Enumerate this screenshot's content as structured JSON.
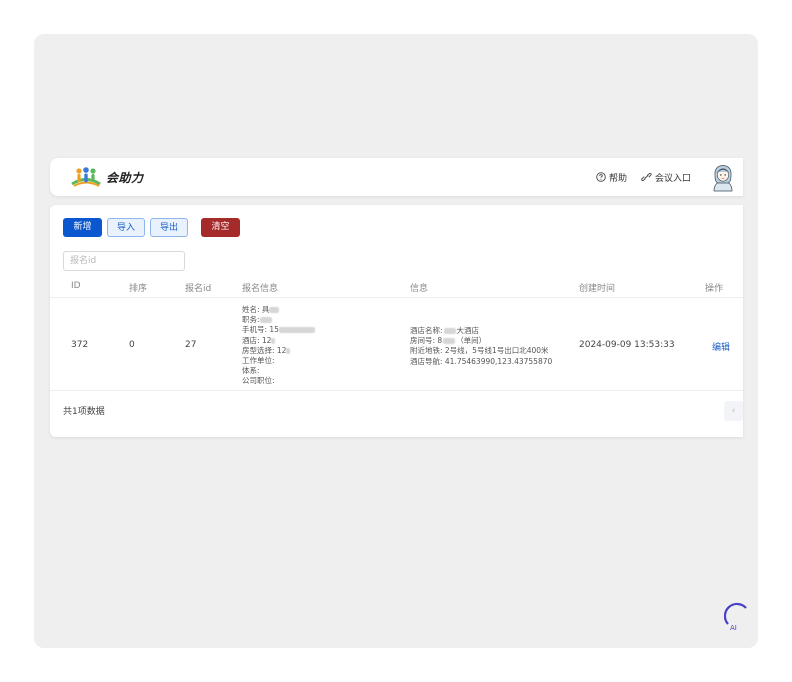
{
  "header": {
    "logo_text": "会助力",
    "help_label": "帮助",
    "meeting_entry_label": "会议入口"
  },
  "toolbar": {
    "add_label": "新增",
    "import_label": "导入",
    "export_label": "导出",
    "clear_label": "清空"
  },
  "search": {
    "placeholder": "报名id"
  },
  "table": {
    "columns": [
      "ID",
      "排序",
      "报名id",
      "报名信息",
      "信息",
      "创建时间",
      "操作"
    ],
    "rows": [
      {
        "id": "372",
        "sort": "0",
        "signup_id": "27",
        "signup_info": {
          "name_label": "姓名: 具",
          "position_label": "职务:",
          "phone_label": "手机号: 15",
          "hotel_label": "酒店: 12",
          "room_type_label": "房型选择: 12",
          "work_unit_label": "工作单位:",
          "system_label": "体系:",
          "company_position_label": "公司职位:"
        },
        "info": {
          "hotel_name_prefix": "酒店名称:",
          "hotel_name_suffix": "大酒店",
          "room_no_prefix": "房间号: 8",
          "room_no_suffix": "（单间）",
          "metro": "附近地铁: 2号线，5号线1号出口北400米",
          "nav": "酒店导航: 41.75463990,123.43755870"
        },
        "created": "2024-09-09 13:53:33",
        "action": "编辑"
      }
    ]
  },
  "footer": {
    "count_text": "共1项数据",
    "prev_page": "‹"
  },
  "icons": {
    "help": "question-circle-icon",
    "link": "link-icon",
    "avatar": "avatar-icon"
  },
  "colors": {
    "primary": "#0b57d0",
    "danger": "#a52a2a",
    "link": "#1c5fc4"
  }
}
